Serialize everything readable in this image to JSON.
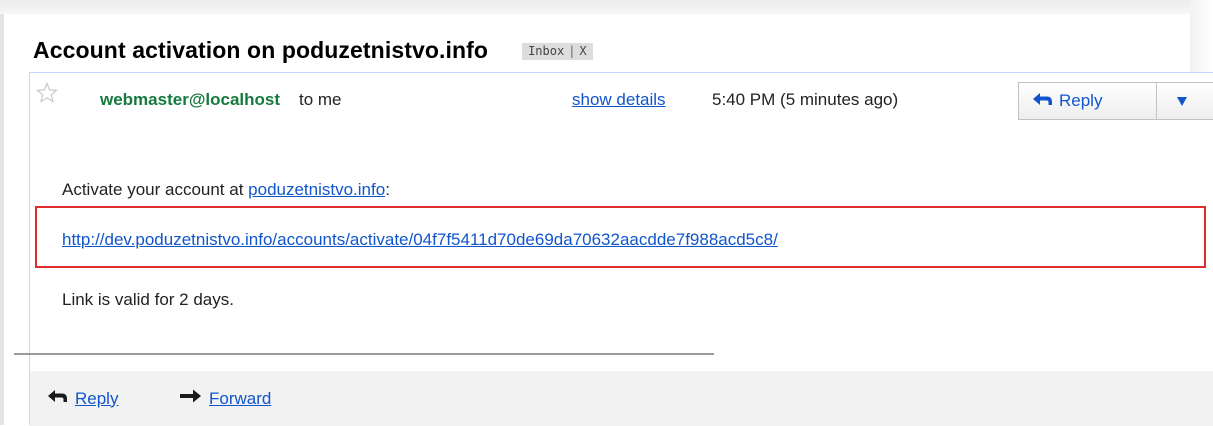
{
  "email": {
    "subject": "Account activation on poduzetnistvo.info",
    "labels": [
      {
        "name": "Inbox",
        "remove": "X"
      }
    ],
    "sender": "webmaster@localhost",
    "recipient": "to me",
    "show_details": "show details",
    "time": "5:40 PM (5 minutes ago)",
    "reply_button": "Reply",
    "body": {
      "line1_prefix": "Activate your account at ",
      "line1_link": "poduzetnistvo.info",
      "line1_suffix": ":",
      "activation_link": "http://dev.poduzetnistvo.info/accounts/activate/04f7f5411d70de69da70632aacdde7f988acd5c8/",
      "line3": "Link is valid for 2 days."
    },
    "footer": {
      "reply": "Reply",
      "forward": "Forward"
    }
  },
  "icons": {
    "star": "star-icon",
    "reply": "reply-arrow-icon",
    "forward": "forward-arrow-icon",
    "dropdown": "chevron-down-icon"
  },
  "colors": {
    "sender": "#157a3e",
    "link": "#1155cc",
    "highlight": "#e02c2c",
    "footer_bg": "#f2f2f2"
  }
}
